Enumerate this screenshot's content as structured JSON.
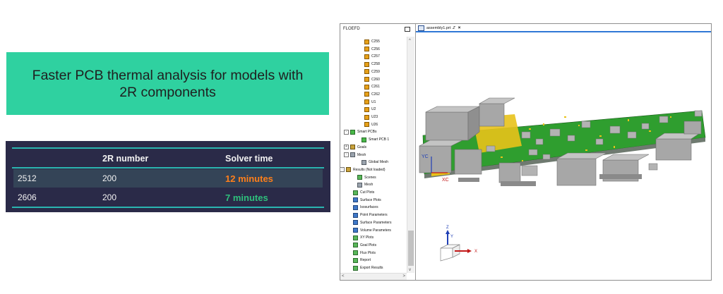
{
  "slide": {
    "title": "Faster PCB thermal analysis for models with\n2R components"
  },
  "table": {
    "headers": [
      "",
      "2R number",
      "Solver time"
    ],
    "rows": [
      {
        "name": "2512",
        "number": "200",
        "time": "12 minutes",
        "time_color": "#ff7f1a"
      },
      {
        "name": "2606",
        "number": "200",
        "time": "7 minutes",
        "time_color": "#2ec07c"
      }
    ]
  },
  "app": {
    "tree_title": "FLOEFD",
    "tab_label": "assembly1.prt",
    "tab_marks": "Z",
    "close_glyph": "×",
    "tree_items": [
      {
        "label": "C255",
        "icon": "component-icon"
      },
      {
        "label": "C256",
        "icon": "component-icon"
      },
      {
        "label": "C257",
        "icon": "component-icon"
      },
      {
        "label": "C258",
        "icon": "component-icon"
      },
      {
        "label": "C259",
        "icon": "component-icon"
      },
      {
        "label": "C260",
        "icon": "component-icon"
      },
      {
        "label": "C261",
        "icon": "component-icon"
      },
      {
        "label": "C262",
        "icon": "component-icon"
      },
      {
        "label": "U1",
        "icon": "component-icon"
      },
      {
        "label": "U2",
        "icon": "component-icon"
      },
      {
        "label": "U23",
        "icon": "component-icon"
      },
      {
        "label": "U26",
        "icon": "component-icon"
      },
      {
        "label": "Smart PCBs",
        "icon": "smart-pcb-folder-icon"
      },
      {
        "label": "Smart PCB 1",
        "icon": "smart-pcb-icon"
      },
      {
        "label": "Goals",
        "icon": "goals-icon"
      },
      {
        "label": "Mesh",
        "icon": "mesh-icon"
      },
      {
        "label": "Global Mesh",
        "icon": "global-mesh-icon"
      },
      {
        "label": "Results (Not loaded)",
        "icon": "results-icon"
      },
      {
        "label": "Scenes",
        "icon": "scenes-icon"
      },
      {
        "label": "Mesh",
        "icon": "mesh-results-icon"
      },
      {
        "label": "Cut Plots",
        "icon": "cut-plots-icon"
      },
      {
        "label": "Surface Plots",
        "icon": "surface-plots-icon"
      },
      {
        "label": "Isosurfaces",
        "icon": "isosurfaces-icon"
      },
      {
        "label": "Point Parameters",
        "icon": "point-parameters-icon"
      },
      {
        "label": "Surface Parameters",
        "icon": "surface-parameters-icon"
      },
      {
        "label": "Volume Parameters",
        "icon": "volume-parameters-icon"
      },
      {
        "label": "XY Plots",
        "icon": "xy-plots-icon"
      },
      {
        "label": "Goal Plots",
        "icon": "goal-plots-icon"
      },
      {
        "label": "Flux Plots",
        "icon": "flux-plots-icon"
      },
      {
        "label": "Report",
        "icon": "report-icon"
      },
      {
        "label": "Export Results",
        "icon": "export-results-icon"
      }
    ],
    "axis_labels": {
      "cs_x": "XC",
      "cs_y": "YC",
      "triad_x": "X",
      "triad_y": "Y",
      "triad_z": "Z"
    }
  },
  "colors": {
    "banner": "#2fd1a0",
    "table_bg": "#2a2a48",
    "table_row_alt": "#344457",
    "table_line": "#2ab5b0",
    "pcb_green": "#2f9e2f",
    "pcb_yellow": "#e8c21a",
    "component_grey": "#a7a7a7"
  }
}
